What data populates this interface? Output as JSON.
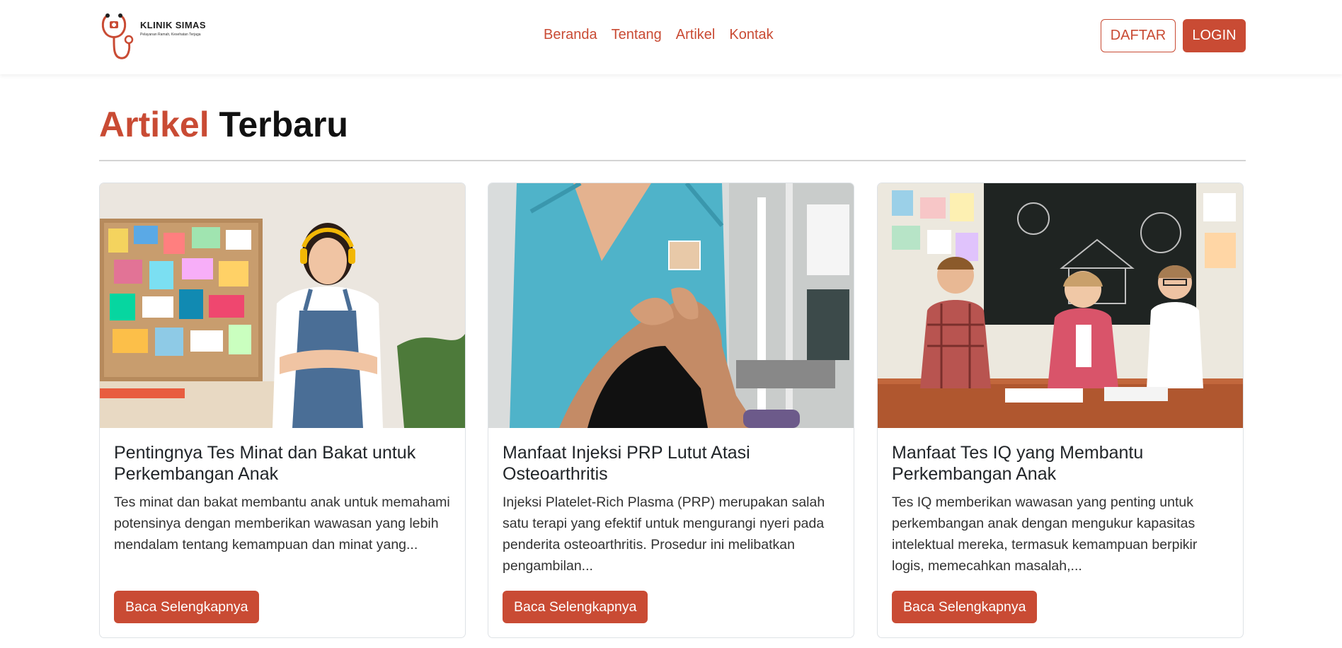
{
  "brand": {
    "name": "KLINIK SIMAS",
    "tagline": "Pelayanan Ramah, Kesehatan Terjaga"
  },
  "nav": {
    "links": [
      "Beranda",
      "Tentang",
      "Artikel",
      "Kontak"
    ],
    "register_label": "DAFTAR",
    "login_label": "LOGIN"
  },
  "colors": {
    "accent": "#c94b34",
    "text": "#212529"
  },
  "section": {
    "title_accent": "Artikel",
    "title_rest": "Terbaru"
  },
  "articles": [
    {
      "title": "Pentingnya Tes Minat dan Bakat untuk Perkembangan Anak",
      "excerpt": "Tes minat dan bakat membantu anak untuk memahami potensinya dengan memberikan wawasan yang lebih mendalam tentang kemampuan dan minat yang...",
      "button_label": "Baca Selengkapnya",
      "image_icon": "photo-girl-with-moodboard"
    },
    {
      "title": "Manfaat Injeksi PRP Lutut Atasi Osteoarthritis",
      "excerpt": "Injeksi Platelet-Rich Plasma (PRP) merupakan salah satu terapi yang efektif untuk mengurangi nyeri pada penderita osteoarthritis. Prosedur ini melibatkan pengambilan...",
      "button_label": "Baca Selengkapnya",
      "image_icon": "photo-knee-examination"
    },
    {
      "title": "Manfaat Tes IQ yang Membantu Perkembangan Anak",
      "excerpt": "Tes IQ memberikan wawasan yang penting untuk perkembangan anak dengan mengukur kapasitas intelektual mereka, termasuk kemampuan berpikir logis, memecahkan masalah,...",
      "button_label": "Baca Selengkapnya",
      "image_icon": "photo-children-drawing"
    }
  ]
}
